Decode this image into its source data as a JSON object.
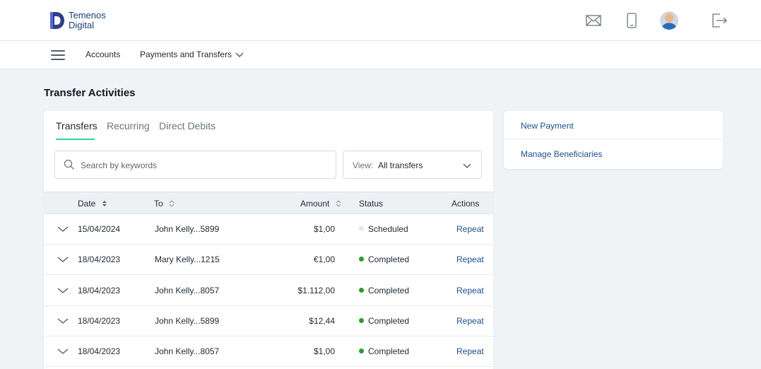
{
  "brand": {
    "line1": "Temenos",
    "line2": "Digital"
  },
  "header": {
    "icons": [
      "mail-icon",
      "mobile-icon",
      "avatar",
      "logout-icon"
    ]
  },
  "nav": {
    "items": [
      {
        "label": "Accounts"
      },
      {
        "label": "Payments and Transfers"
      }
    ]
  },
  "page": {
    "title": "Transfer Activities"
  },
  "tabs": [
    {
      "label": "Transfers",
      "active": true
    },
    {
      "label": "Recurring",
      "active": false
    },
    {
      "label": "Direct Debits",
      "active": false
    }
  ],
  "search": {
    "placeholder": "Search by keywords",
    "value": ""
  },
  "view": {
    "label": "View:",
    "value": "All transfers"
  },
  "table": {
    "columns": {
      "date": "Date",
      "to": "To",
      "amount": "Amount",
      "status": "Status",
      "actions": "Actions"
    },
    "rows": [
      {
        "date": "15/04/2024",
        "to": "John Kelly...5899",
        "amount": "$1,00",
        "status": "Scheduled",
        "status_color": "#e3e6ea",
        "action": "Repeat"
      },
      {
        "date": "18/04/2023",
        "to": "Mary Kelly...1215",
        "amount": "€1,00",
        "status": "Completed",
        "status_color": "#2a9d2a",
        "action": "Repeat"
      },
      {
        "date": "18/04/2023",
        "to": "John Kelly...8057",
        "amount": "$1.112,00",
        "status": "Completed",
        "status_color": "#2a9d2a",
        "action": "Repeat"
      },
      {
        "date": "18/04/2023",
        "to": "John Kelly...5899",
        "amount": "$12,44",
        "status": "Completed",
        "status_color": "#2a9d2a",
        "action": "Repeat"
      },
      {
        "date": "18/04/2023",
        "to": "John Kelly...8057",
        "amount": "$1,00",
        "status": "Completed",
        "status_color": "#2a9d2a",
        "action": "Repeat"
      }
    ]
  },
  "side_links": [
    {
      "label": "New Payment"
    },
    {
      "label": "Manage Beneficiaries"
    }
  ],
  "colors": {
    "accent_underline": "#2bd4a4",
    "link": "#1d4f91",
    "brand": "#1d3f7a"
  }
}
